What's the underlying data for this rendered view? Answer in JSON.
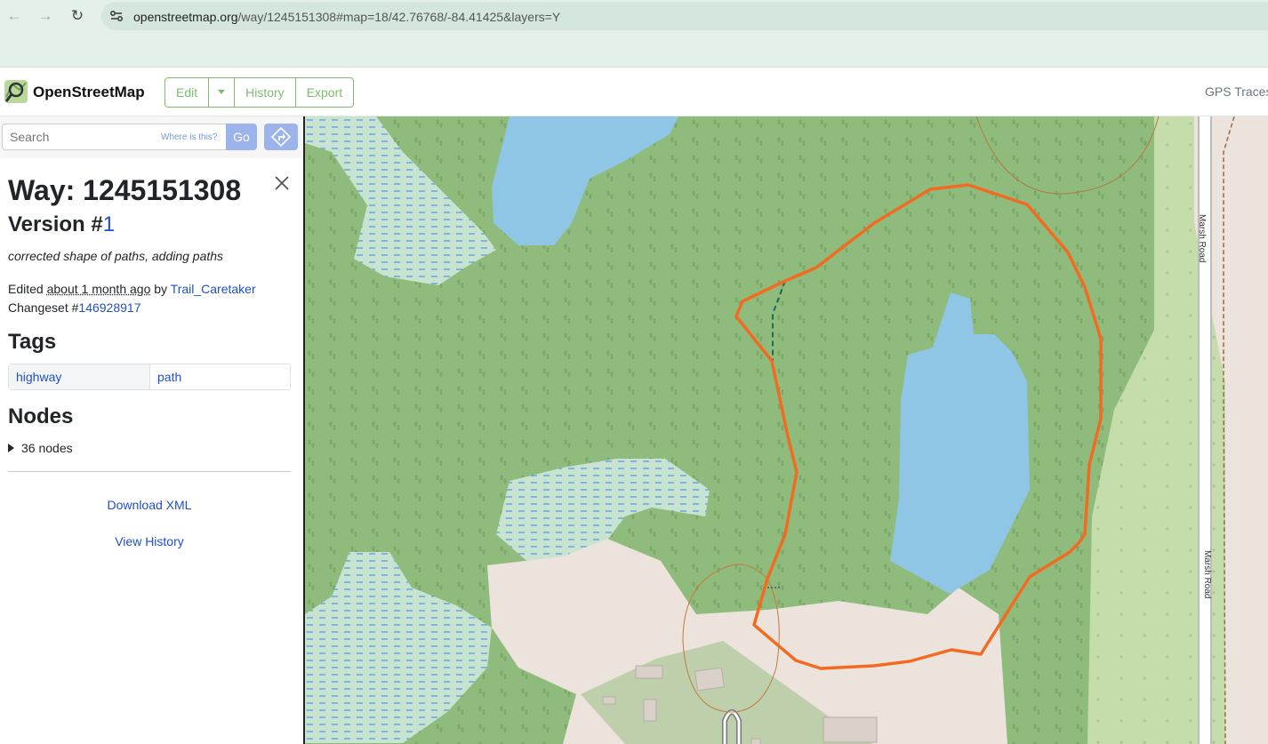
{
  "browser": {
    "url_host": "openstreetmap.org",
    "url_path": "/way/1245151308#map=18/42.76768/-84.41425&layers=Y"
  },
  "header": {
    "brand": "OpenStreetMap",
    "edit": "Edit",
    "history": "History",
    "export": "Export",
    "gps_traces": "GPS Traces"
  },
  "search": {
    "placeholder": "Search",
    "where_is_this": "Where is this?",
    "go": "Go"
  },
  "way": {
    "title": "Way: 1245151308",
    "version_prefix": "Version #",
    "version_number": "1",
    "comment": "corrected shape of paths, adding paths",
    "edited_prefix": "Edited ",
    "edited_time": "about 1 month ago",
    "edited_by": " by ",
    "user": "Trail_Caretaker",
    "changeset_prefix": "Changeset #",
    "changeset_id": "146928917"
  },
  "tags": {
    "heading": "Tags",
    "rows": [
      {
        "key": "highway",
        "value": "path"
      }
    ]
  },
  "nodes": {
    "heading": "Nodes",
    "summary": "36 nodes"
  },
  "links": {
    "download_xml": "Download XML",
    "view_history": "View History"
  },
  "map": {
    "road_name_top": "Marsh Road",
    "road_name_bottom": "Marsh Road",
    "colors": {
      "forest": "#8fbb7c",
      "water": "#8fc6e6",
      "wetland": "#c7e3d1",
      "residential": "#ece3dc",
      "farmland": "#c5dcab",
      "highlight": "#f26b21"
    }
  }
}
